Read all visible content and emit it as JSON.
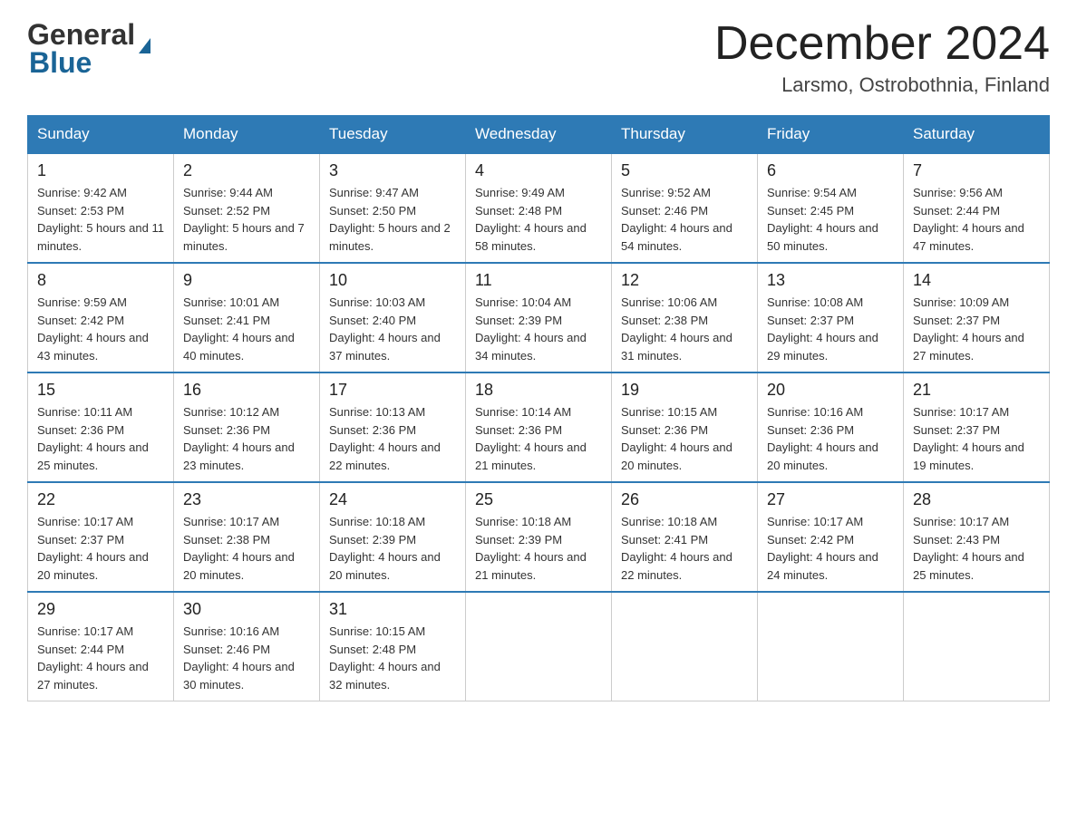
{
  "logo": {
    "general": "General",
    "blue": "Blue"
  },
  "title": {
    "month_year": "December 2024",
    "location": "Larsmo, Ostrobothnia, Finland"
  },
  "weekdays": [
    "Sunday",
    "Monday",
    "Tuesday",
    "Wednesday",
    "Thursday",
    "Friday",
    "Saturday"
  ],
  "weeks": [
    [
      {
        "day": "1",
        "sunrise": "9:42 AM",
        "sunset": "2:53 PM",
        "daylight": "5 hours and 11 minutes."
      },
      {
        "day": "2",
        "sunrise": "9:44 AM",
        "sunset": "2:52 PM",
        "daylight": "5 hours and 7 minutes."
      },
      {
        "day": "3",
        "sunrise": "9:47 AM",
        "sunset": "2:50 PM",
        "daylight": "5 hours and 2 minutes."
      },
      {
        "day": "4",
        "sunrise": "9:49 AM",
        "sunset": "2:48 PM",
        "daylight": "4 hours and 58 minutes."
      },
      {
        "day": "5",
        "sunrise": "9:52 AM",
        "sunset": "2:46 PM",
        "daylight": "4 hours and 54 minutes."
      },
      {
        "day": "6",
        "sunrise": "9:54 AM",
        "sunset": "2:45 PM",
        "daylight": "4 hours and 50 minutes."
      },
      {
        "day": "7",
        "sunrise": "9:56 AM",
        "sunset": "2:44 PM",
        "daylight": "4 hours and 47 minutes."
      }
    ],
    [
      {
        "day": "8",
        "sunrise": "9:59 AM",
        "sunset": "2:42 PM",
        "daylight": "4 hours and 43 minutes."
      },
      {
        "day": "9",
        "sunrise": "10:01 AM",
        "sunset": "2:41 PM",
        "daylight": "4 hours and 40 minutes."
      },
      {
        "day": "10",
        "sunrise": "10:03 AM",
        "sunset": "2:40 PM",
        "daylight": "4 hours and 37 minutes."
      },
      {
        "day": "11",
        "sunrise": "10:04 AM",
        "sunset": "2:39 PM",
        "daylight": "4 hours and 34 minutes."
      },
      {
        "day": "12",
        "sunrise": "10:06 AM",
        "sunset": "2:38 PM",
        "daylight": "4 hours and 31 minutes."
      },
      {
        "day": "13",
        "sunrise": "10:08 AM",
        "sunset": "2:37 PM",
        "daylight": "4 hours and 29 minutes."
      },
      {
        "day": "14",
        "sunrise": "10:09 AM",
        "sunset": "2:37 PM",
        "daylight": "4 hours and 27 minutes."
      }
    ],
    [
      {
        "day": "15",
        "sunrise": "10:11 AM",
        "sunset": "2:36 PM",
        "daylight": "4 hours and 25 minutes."
      },
      {
        "day": "16",
        "sunrise": "10:12 AM",
        "sunset": "2:36 PM",
        "daylight": "4 hours and 23 minutes."
      },
      {
        "day": "17",
        "sunrise": "10:13 AM",
        "sunset": "2:36 PM",
        "daylight": "4 hours and 22 minutes."
      },
      {
        "day": "18",
        "sunrise": "10:14 AM",
        "sunset": "2:36 PM",
        "daylight": "4 hours and 21 minutes."
      },
      {
        "day": "19",
        "sunrise": "10:15 AM",
        "sunset": "2:36 PM",
        "daylight": "4 hours and 20 minutes."
      },
      {
        "day": "20",
        "sunrise": "10:16 AM",
        "sunset": "2:36 PM",
        "daylight": "4 hours and 20 minutes."
      },
      {
        "day": "21",
        "sunrise": "10:17 AM",
        "sunset": "2:37 PM",
        "daylight": "4 hours and 19 minutes."
      }
    ],
    [
      {
        "day": "22",
        "sunrise": "10:17 AM",
        "sunset": "2:37 PM",
        "daylight": "4 hours and 20 minutes."
      },
      {
        "day": "23",
        "sunrise": "10:17 AM",
        "sunset": "2:38 PM",
        "daylight": "4 hours and 20 minutes."
      },
      {
        "day": "24",
        "sunrise": "10:18 AM",
        "sunset": "2:39 PM",
        "daylight": "4 hours and 20 minutes."
      },
      {
        "day": "25",
        "sunrise": "10:18 AM",
        "sunset": "2:39 PM",
        "daylight": "4 hours and 21 minutes."
      },
      {
        "day": "26",
        "sunrise": "10:18 AM",
        "sunset": "2:41 PM",
        "daylight": "4 hours and 22 minutes."
      },
      {
        "day": "27",
        "sunrise": "10:17 AM",
        "sunset": "2:42 PM",
        "daylight": "4 hours and 24 minutes."
      },
      {
        "day": "28",
        "sunrise": "10:17 AM",
        "sunset": "2:43 PM",
        "daylight": "4 hours and 25 minutes."
      }
    ],
    [
      {
        "day": "29",
        "sunrise": "10:17 AM",
        "sunset": "2:44 PM",
        "daylight": "4 hours and 27 minutes."
      },
      {
        "day": "30",
        "sunrise": "10:16 AM",
        "sunset": "2:46 PM",
        "daylight": "4 hours and 30 minutes."
      },
      {
        "day": "31",
        "sunrise": "10:15 AM",
        "sunset": "2:48 PM",
        "daylight": "4 hours and 32 minutes."
      },
      null,
      null,
      null,
      null
    ]
  ],
  "labels": {
    "sunrise_prefix": "Sunrise: ",
    "sunset_prefix": "Sunset: ",
    "daylight_prefix": "Daylight: "
  }
}
